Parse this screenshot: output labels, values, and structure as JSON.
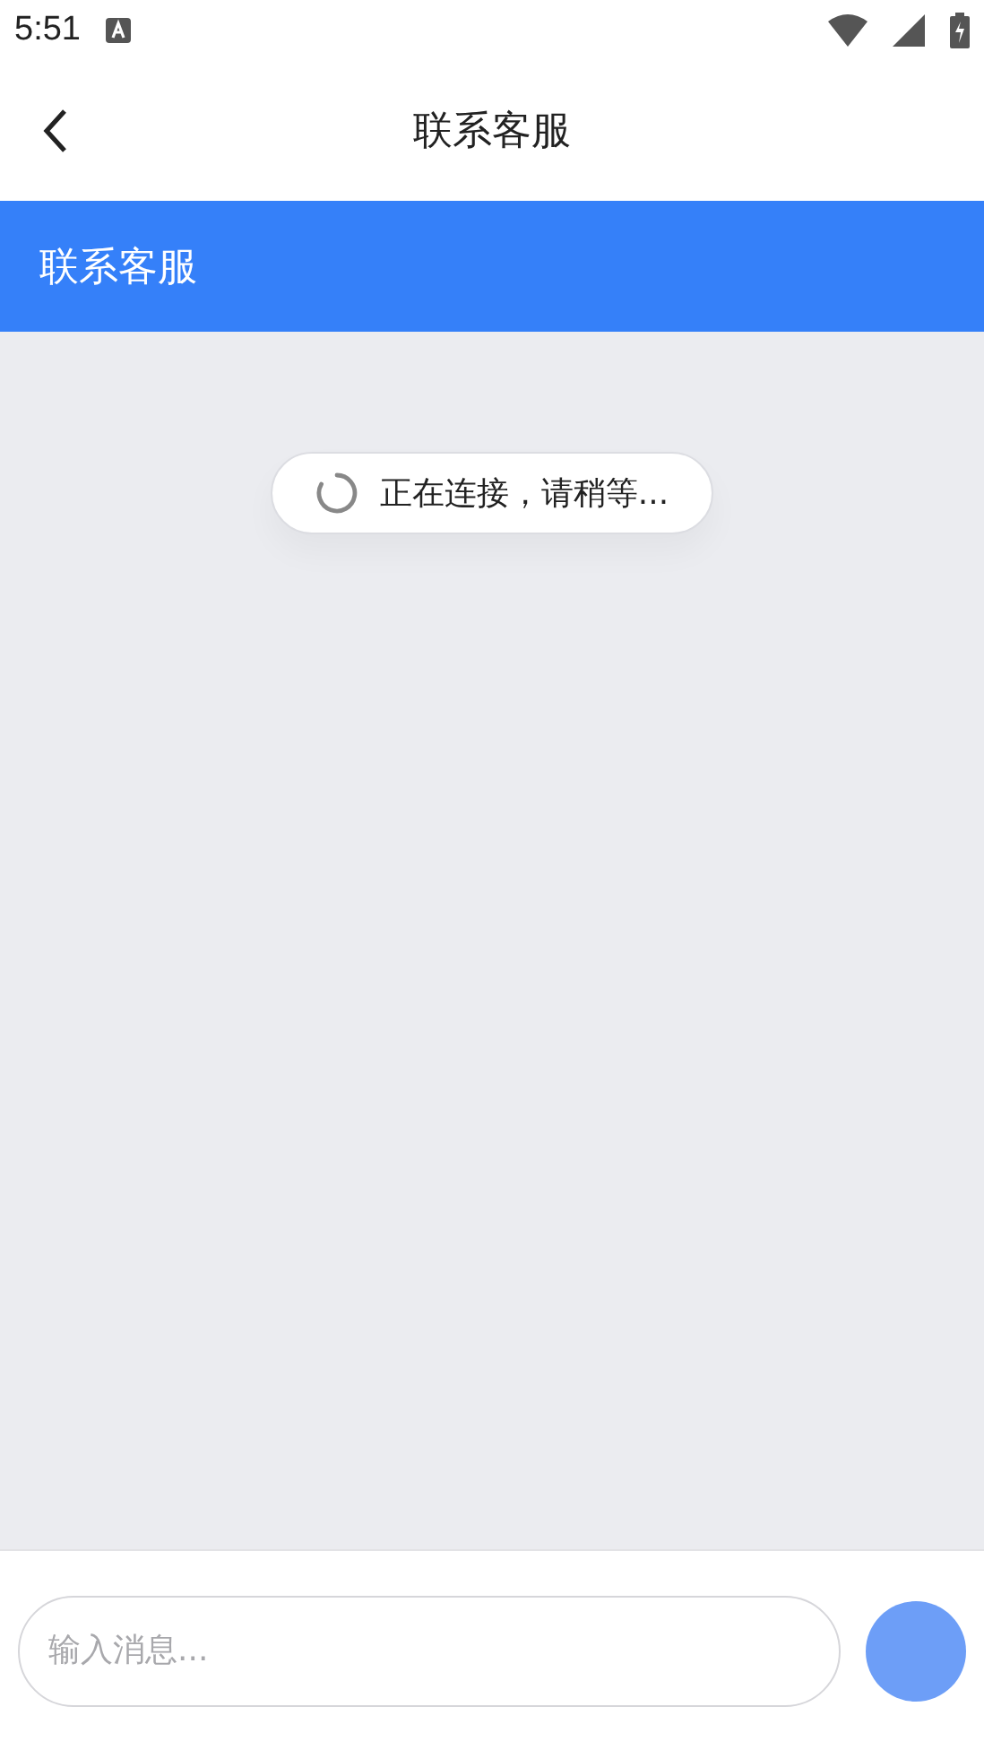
{
  "status_bar": {
    "time": "5:51"
  },
  "app_bar": {
    "title": "联系客服"
  },
  "header": {
    "title": "联系客服"
  },
  "loading": {
    "text": "正在连接，请稍等..."
  },
  "composer": {
    "placeholder": "输入消息..."
  }
}
